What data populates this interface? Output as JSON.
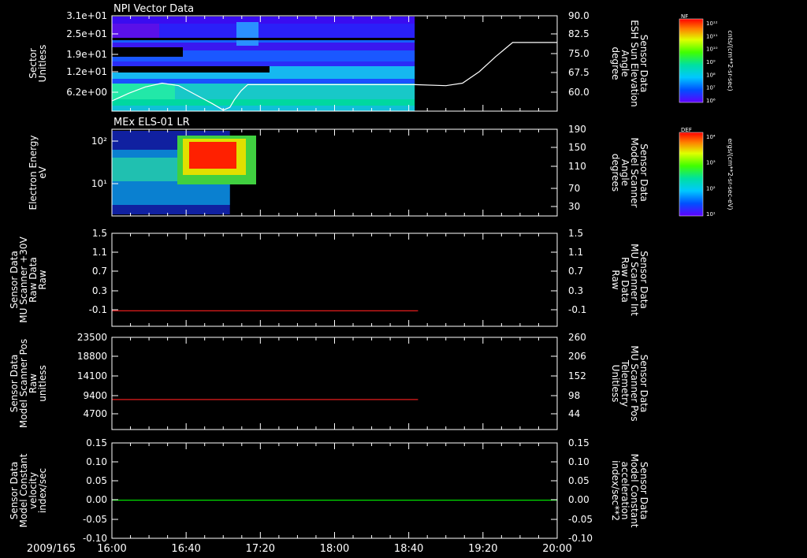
{
  "date_label": "2009/165",
  "time_ticks": [
    "16:00",
    "16:40",
    "17:20",
    "18:00",
    "18:40",
    "19:20",
    "20:00"
  ],
  "colors": {
    "axis": "#ffffff",
    "red_line": "#ff2020",
    "green_line": "#00e000",
    "red_label": "#ff2020",
    "green_label": "#00e000"
  },
  "chart_data": [
    {
      "type": "heatmap",
      "title": "NPI Vector Data",
      "ylabel_left": [
        "Sector",
        "Unitless"
      ],
      "yticks_left": [
        "3.1e+01",
        "2.5e+01",
        "1.9e+01",
        "1.2e+01",
        "6.2e+00"
      ],
      "ylabel_right": [
        "Sensor Data",
        "ESH Sun Elevation",
        "Angle",
        "degree"
      ],
      "yticks_right": [
        "90.0",
        "82.5",
        "75.0",
        "67.5",
        "60.0"
      ],
      "ylim_right": [
        52.5,
        90
      ],
      "colorbar_title": "NF",
      "colorbar_ticks": [
        "10¹²",
        "10¹¹",
        "10¹⁰",
        "10⁹",
        "10⁸",
        "10⁷",
        "10⁶"
      ],
      "colorbar_unit": "cnts/(cm**2-sr-sec)",
      "data_coverage_hours": [
        16.0,
        18.72
      ],
      "sun_elevation": {
        "x": [
          16.0,
          16.15,
          16.3,
          16.45,
          16.6,
          16.75,
          16.9,
          17.0,
          17.06,
          17.1,
          17.16,
          17.22,
          17.4,
          18.0,
          18.5,
          18.72,
          19.0,
          19.15,
          19.3,
          19.45,
          19.6,
          20.0
        ],
        "y": [
          56.5,
          59.5,
          62.0,
          63.5,
          62.5,
          59.0,
          55.5,
          52.9,
          54.0,
          57.0,
          60.5,
          62.9,
          62.9,
          62.9,
          62.9,
          62.9,
          62.5,
          63.5,
          68.0,
          74.0,
          79.5,
          79.5
        ]
      }
    },
    {
      "type": "heatmap",
      "title": "MEx ELS-01 LR",
      "ylabel_left": [
        "Electron Energy",
        "eV"
      ],
      "yticks_left": [
        "10²",
        "10¹"
      ],
      "ylabel_right": [
        "Sensor Data",
        "Model Scanner",
        "Angle",
        "degrees"
      ],
      "yticks_right": [
        "190",
        "150",
        "110",
        "70",
        "30"
      ],
      "ylim_right": [
        10,
        190
      ],
      "colorbar_title": "DEF",
      "colorbar_ticks": [
        "10⁴",
        "10³",
        "10²",
        "10¹"
      ],
      "colorbar_unit": "ergs/(cm**2-sr-sec-eV)",
      "data_coverage_hours": [
        16.0,
        17.06
      ],
      "scanner_angle": {
        "x": [
          16.0,
          20.0
        ],
        "y": [
          10,
          10
        ]
      }
    },
    {
      "type": "line",
      "ylabel_left": [
        "Sensor Data",
        "MU Scanner +30V",
        "Raw Data",
        "Raw"
      ],
      "yticks_left": [
        "1.5",
        "1.1",
        "0.7",
        "0.3",
        "-0.1"
      ],
      "ylim_left": [
        -0.3,
        1.5
      ],
      "ylabel_right": [
        "Sensor Data",
        "MU Scanner Int",
        "Raw Data",
        "Raw"
      ],
      "yticks_right": [
        "1.5",
        "1.1",
        "0.7",
        "0.3",
        "-0.1"
      ],
      "series": [
        {
          "x": [
            16.0,
            18.75
          ],
          "y": [
            0.0,
            0.0
          ]
        }
      ]
    },
    {
      "type": "line",
      "ylabel_left": [
        "Sensor Data",
        "Model Scanner Pos",
        "Raw",
        "unitless"
      ],
      "yticks_left": [
        "23500",
        "18800",
        "14100",
        "9400",
        "4700"
      ],
      "ylim_left": [
        0,
        23500
      ],
      "ylabel_right": [
        "Sensor Data",
        "MU Scanner Pos",
        "Telemetry",
        "Unitless"
      ],
      "yticks_right": [
        "260",
        "206",
        "152",
        "98",
        "44"
      ],
      "series": [
        {
          "x": [
            16.0,
            18.75
          ],
          "y": [
            7650,
            7650
          ]
        }
      ]
    },
    {
      "type": "line",
      "ylabel_left": [
        "Sensor Data",
        "Model Constant",
        "velocity",
        "index/sec"
      ],
      "yticks_left": [
        "0.15",
        "0.10",
        "0.05",
        "0.00",
        "-0.05",
        "-0.10"
      ],
      "ylim_left": [
        -0.1,
        0.15
      ],
      "ylabel_right": [
        "Sensor Data",
        "Model Constant",
        "acceleration",
        "index/sec**2"
      ],
      "yticks_right": [
        "0.15",
        "0.10",
        "0.05",
        "0.00",
        "-0.05",
        "-0.10"
      ],
      "series": [
        {
          "x": [
            16.0,
            20.0
          ],
          "y": [
            0.0,
            0.0
          ]
        }
      ]
    }
  ]
}
